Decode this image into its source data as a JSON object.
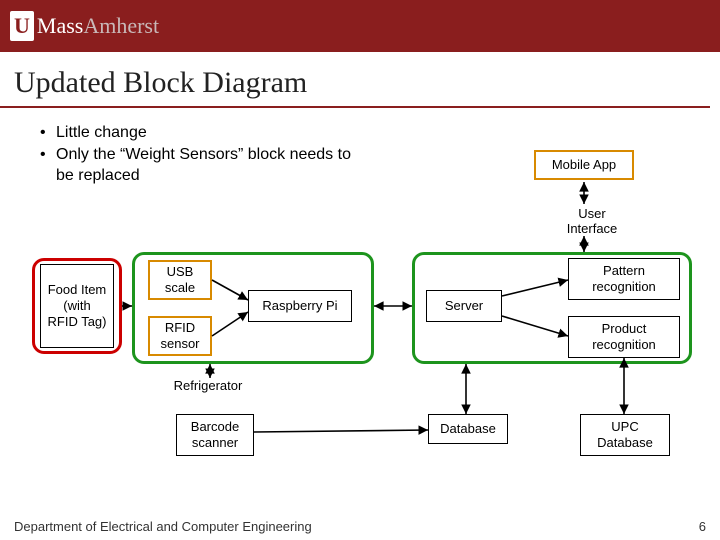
{
  "header": {
    "logo_u": "U",
    "logo_mass": "Mass",
    "logo_amherst": "Amherst"
  },
  "title": "Updated Block Diagram",
  "bullets": [
    "Little change",
    "Only the “Weight Sensors” block needs to be replaced"
  ],
  "blocks": {
    "mobile_app": "Mobile App",
    "user_interface": "User Interface",
    "food_item": "Food Item (with RFID Tag)",
    "usb_scale": "USB scale",
    "rfid_sensor": "RFID sensor",
    "raspberry_pi": "Raspberry Pi",
    "server": "Server",
    "pattern_recognition": "Pattern recognition",
    "product_recognition": "Product recognition",
    "refrigerator": "Refrigerator",
    "barcode_scanner": "Barcode scanner",
    "database": "Database",
    "upc_database": "UPC Database"
  },
  "footer": "Department of Electrical and Computer Engineering",
  "page_number": "6"
}
